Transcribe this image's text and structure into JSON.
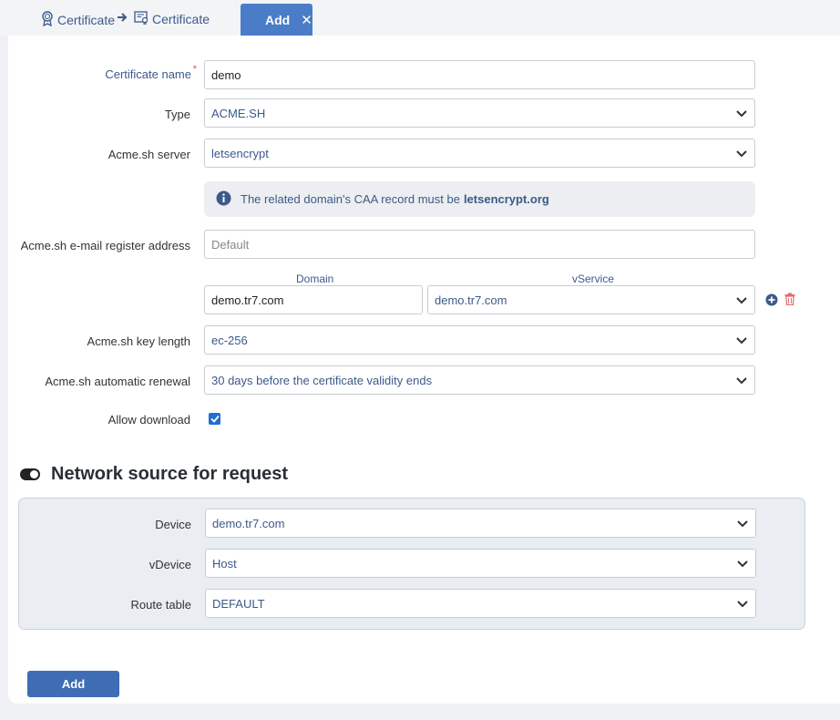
{
  "breadcrumb": {
    "item1": "Certificate",
    "item2": "Certificate",
    "active_tab": "Add",
    "close_glyph": "✕"
  },
  "form": {
    "cert_name": {
      "label": "Certificate name",
      "required_mark": "*",
      "value": "demo"
    },
    "type": {
      "label": "Type",
      "value": "ACME.SH"
    },
    "acme_server": {
      "label": "Acme.sh server",
      "value": "letsencrypt"
    },
    "info": {
      "text": "The related domain's CAA record must be",
      "bold": "letsencrypt.org"
    },
    "email": {
      "label": "Acme.sh e-mail register address",
      "placeholder": "Default"
    },
    "domain_table": {
      "col_domain": "Domain",
      "col_vservice": "vService",
      "rows": [
        {
          "domain": "demo.tr7.com",
          "vservice": "demo.tr7.com"
        }
      ]
    },
    "key_length": {
      "label": "Acme.sh key length",
      "value": "ec-256"
    },
    "renewal": {
      "label": "Acme.sh automatic renewal",
      "value": "30 days before the certificate validity ends"
    },
    "allow_download": {
      "label": "Allow download",
      "checked": true
    }
  },
  "network": {
    "title": "Network source for request",
    "device": {
      "label": "Device",
      "value": "demo.tr7.com"
    },
    "vdevice": {
      "label": "vDevice",
      "value": "Host"
    },
    "route_table": {
      "label": "Route table",
      "value": "DEFAULT"
    }
  },
  "submit_label": "Add",
  "colors": {
    "accent": "#4a7cc7",
    "link": "#3c5a8a",
    "danger": "#e06b6b",
    "check": "#1f6fd1"
  }
}
